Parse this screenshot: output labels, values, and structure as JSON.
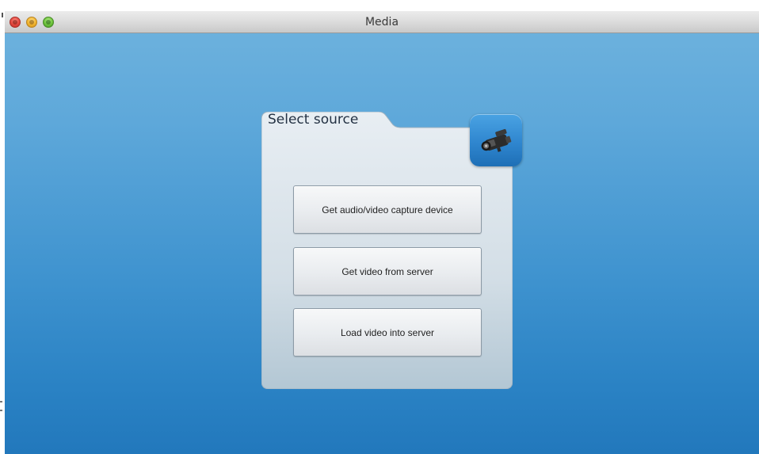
{
  "window": {
    "title": "Media"
  },
  "panel": {
    "title": "Select source",
    "icon": "video-camera-icon",
    "buttons": [
      {
        "label": "Get audio/video capture device"
      },
      {
        "label": "Get video from server"
      },
      {
        "label": "Load video into server"
      }
    ]
  },
  "colors": {
    "background_top": "#6fb3de",
    "background_bottom": "#2278bc",
    "panel": "#d9e2ea",
    "icon_tile": "#2f86cf"
  }
}
